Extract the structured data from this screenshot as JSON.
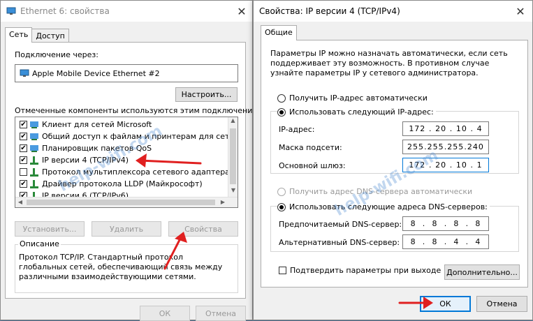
{
  "left_window": {
    "title": "Ethernet 6: свойства",
    "tabs": [
      "Сеть",
      "Доступ"
    ],
    "connect_via_label": "Подключение через:",
    "adapter_name": "Apple Mobile Device Ethernet #2",
    "configure_button": "Настроить...",
    "components_label": "Отмеченные компоненты используются этим подключением:",
    "components": [
      {
        "label": "Клиент для сетей Microsoft",
        "checked": true
      },
      {
        "label": "Общий доступ к файлам и принтерам для сетей Mi",
        "checked": true
      },
      {
        "label": "Планировщик пакетов QoS",
        "checked": true
      },
      {
        "label": "IP версии 4 (TCP/IPv4)",
        "checked": true
      },
      {
        "label": "Протокол мультиплексора сетевого адаптера (Май",
        "checked": false
      },
      {
        "label": "Драйвер протокола LLDP (Майкрософт)",
        "checked": true
      },
      {
        "label": "IP версии 6 (TCP/IPv6)",
        "checked": true
      }
    ],
    "install_button": "Установить...",
    "remove_button": "Удалить",
    "properties_button": "Свойства",
    "description_legend": "Описание",
    "description_text": "Протокол TCP/IP. Стандартный протокол глобальных сетей, обеспечивающий связь между различными взаимодействующими сетями.",
    "ok_button": "ОК",
    "cancel_button": "Отмена"
  },
  "right_window": {
    "title": "Свойства: IP версии 4 (TCP/IPv4)",
    "tab": "Общие",
    "intro_text": "Параметры IP можно назначать автоматически, если сеть поддерживает эту возможность. В противном случае узнайте параметры IP у сетевого администратора.",
    "auto_ip_label": "Получить IP-адрес автоматически",
    "manual_ip_label": "Использовать следующий IP-адрес:",
    "ip_label": "IP-адрес:",
    "ip_value": [
      "172",
      "20",
      "10",
      "4"
    ],
    "mask_label": "Маска подсети:",
    "mask_value": [
      "255",
      "255",
      "255",
      "240"
    ],
    "gateway_label": "Основной шлюз:",
    "gateway_value": [
      "172",
      "20",
      "10",
      "1"
    ],
    "auto_dns_label": "Получить адрес DNS-сервера автоматически",
    "manual_dns_label": "Использовать следующие адреса DNS-серверов:",
    "preferred_dns_label": "Предпочитаемый DNS-сервер:",
    "preferred_dns_value": [
      "8",
      "8",
      "8",
      "8"
    ],
    "alternate_dns_label": "Альтернативный DNS-сервер:",
    "alternate_dns_value": [
      "8",
      "8",
      "4",
      "4"
    ],
    "validate_label": "Подтвердить параметры при выходе",
    "advanced_button": "Дополнительно...",
    "ok_button": "ОК",
    "cancel_button": "Отмена"
  },
  "watermark": "help-wifi.com",
  "colors": {
    "arrow": "#e02020",
    "accent": "#0078d7"
  }
}
